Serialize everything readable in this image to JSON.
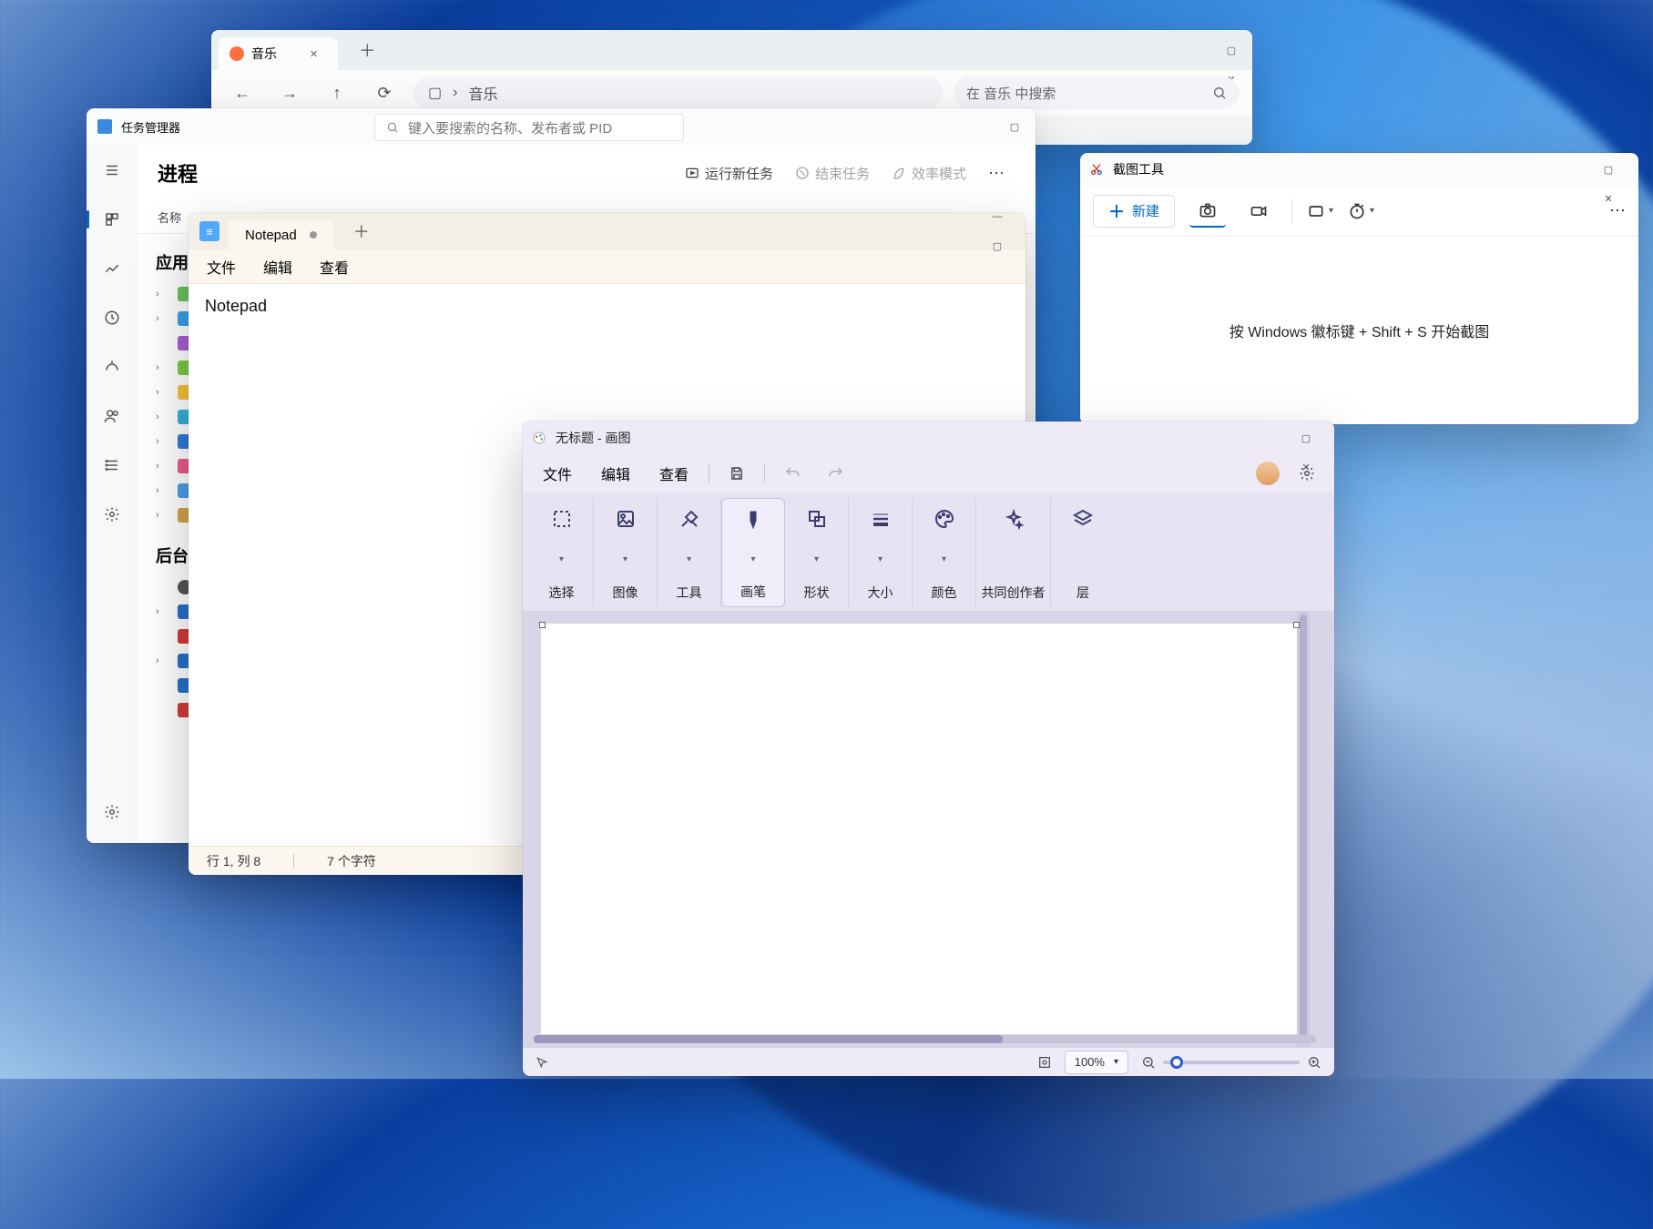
{
  "music": {
    "tab_label": "音乐",
    "breadcrumb": "音乐",
    "search_placeholder": "在 音乐 中搜索"
  },
  "taskmgr": {
    "title": "任务管理器",
    "search_placeholder": "键入要搜索的名称、发布者或 PID",
    "heading": "进程",
    "run_new_task": "运行新任务",
    "end_task": "结束任务",
    "efficiency_mode": "效率模式",
    "col_name": "名称",
    "group_apps": "应用",
    "group_bg": "后台"
  },
  "notepad": {
    "tab_label": "Notepad",
    "menu_file": "文件",
    "menu_edit": "编辑",
    "menu_view": "查看",
    "content": "Notepad",
    "status_pos": "行 1, 列 8",
    "status_chars": "7 个字符"
  },
  "snip": {
    "title": "截图工具",
    "new_label": "新建",
    "hint": "按 Windows 徽标键 + Shift + S 开始截图"
  },
  "paint": {
    "title": "无标题 - 画图",
    "menu_file": "文件",
    "menu_edit": "编辑",
    "menu_view": "查看",
    "grp_select": "选择",
    "grp_image": "图像",
    "grp_tools": "工具",
    "grp_brush": "画笔",
    "grp_shape": "形状",
    "grp_size": "大小",
    "grp_color": "颜色",
    "grp_cocreate": "共同创作者",
    "grp_layer": "层",
    "zoom": "100%"
  }
}
